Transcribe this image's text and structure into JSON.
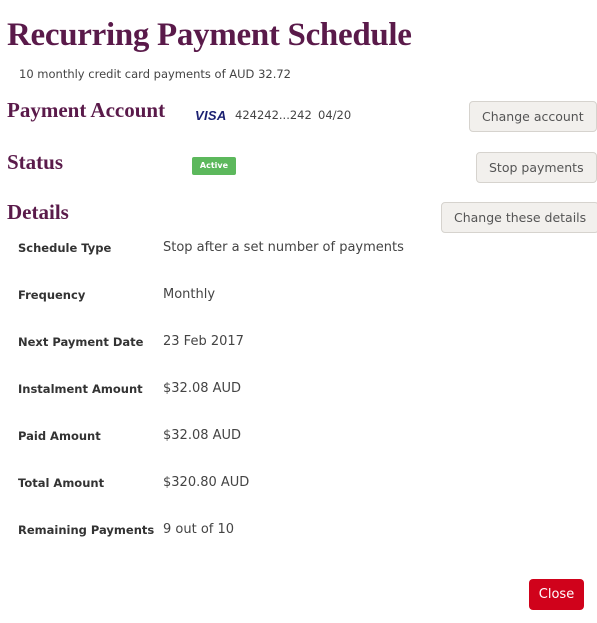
{
  "header": {
    "title": "Recurring Payment Schedule",
    "subtitle": "10 monthly credit card payments of AUD 32.72"
  },
  "payment_account": {
    "heading": "Payment Account",
    "card_brand": "VISA",
    "card_number": "424242...242",
    "card_expiry": "04/20",
    "change_button": "Change account"
  },
  "status": {
    "heading": "Status",
    "badge": "Active",
    "badge_color": "#5cb85c",
    "stop_button": "Stop payments"
  },
  "details": {
    "heading": "Details",
    "change_button": "Change these details",
    "rows": [
      {
        "label": "Schedule Type",
        "value": "Stop after a set number of payments"
      },
      {
        "label": "Frequency",
        "value": "Monthly"
      },
      {
        "label": "Next Payment Date",
        "value": "23 Feb 2017"
      },
      {
        "label": "Instalment Amount",
        "value": "$32.08 AUD"
      },
      {
        "label": "Paid Amount",
        "value": "$32.08 AUD"
      },
      {
        "label": "Total Amount",
        "value": "$320.80 AUD"
      },
      {
        "label": "Remaining Payments",
        "value": "9 out of 10"
      }
    ]
  },
  "footer": {
    "close_button": "Close",
    "close_color": "#d0021b"
  },
  "colors": {
    "heading": "#5a1a4a"
  }
}
